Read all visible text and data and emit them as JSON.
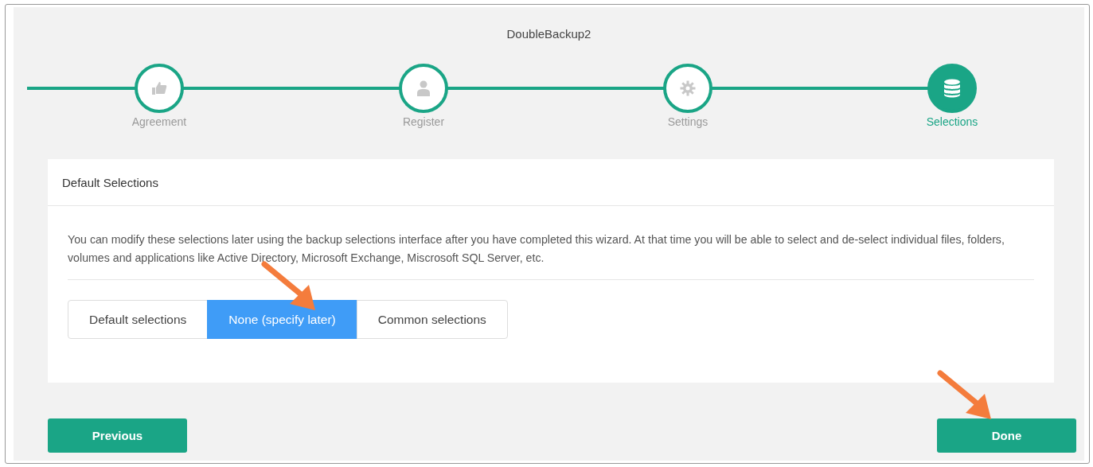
{
  "window": {
    "title": "DoubleBackup2"
  },
  "steps": [
    {
      "label": "Agreement",
      "selected": false
    },
    {
      "label": "Register",
      "selected": false
    },
    {
      "label": "Settings",
      "selected": false
    },
    {
      "label": "Selections",
      "selected": true
    }
  ],
  "card": {
    "title": "Default Selections",
    "description": "You can modify these selections later using the backup selections interface after you have completed this wizard. At that time you will be able to select and de-select individual files, folders, volumes and applications like Active Directory, Microsoft Exchange, Miscrosoft SQL Server, etc.",
    "options": [
      {
        "label": "Default selections",
        "selected": false
      },
      {
        "label": "None (specify later)",
        "selected": true
      },
      {
        "label": "Common selections",
        "selected": false
      }
    ]
  },
  "buttons": [
    {
      "label": "Previous"
    },
    {
      "label": "Done"
    }
  ]
}
